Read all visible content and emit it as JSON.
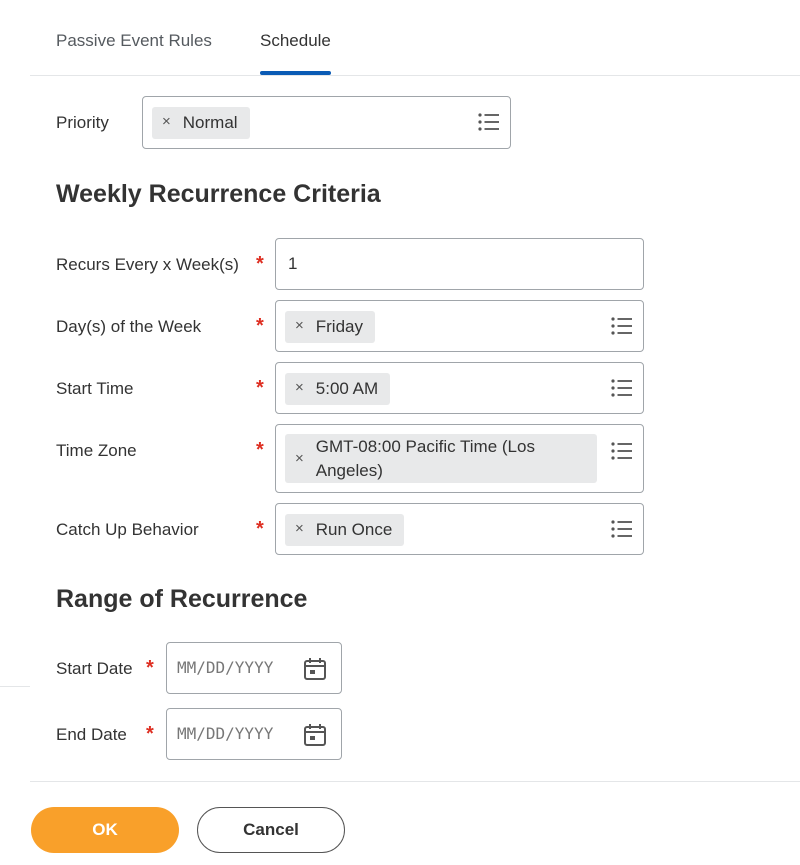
{
  "tabs": [
    {
      "label": "Passive Event Rules",
      "active": false
    },
    {
      "label": "Schedule",
      "active": true
    }
  ],
  "priority": {
    "label": "Priority",
    "value": "Normal"
  },
  "weekly": {
    "heading": "Weekly Recurrence Criteria",
    "recurs_every": {
      "label": "Recurs Every x Week(s)",
      "value": "1"
    },
    "days_of_week": {
      "label": "Day(s) of the Week",
      "value": "Friday"
    },
    "start_time": {
      "label": "Start Time",
      "value": "5:00 AM"
    },
    "time_zone": {
      "label": "Time Zone",
      "value_line1": "GMT-08:00 Pacific Time (Los",
      "value_line2": "Angeles)"
    },
    "catch_up": {
      "label": "Catch Up Behavior",
      "value": "Run Once"
    }
  },
  "range": {
    "heading": "Range of Recurrence",
    "start_date": {
      "label": "Start Date",
      "placeholder": "MM/DD/YYYY"
    },
    "end_date": {
      "label": "End Date",
      "placeholder": "MM/DD/YYYY"
    }
  },
  "required_marker": "*",
  "remove_glyph": "×",
  "buttons": {
    "ok": "OK",
    "cancel": "Cancel"
  },
  "colors": {
    "accent": "#0a5bb5",
    "required": "#de2e21",
    "primary_button": "#f9a02a"
  },
  "icons": {
    "list": "list-icon",
    "calendar": "calendar-icon",
    "remove": "close-icon"
  }
}
